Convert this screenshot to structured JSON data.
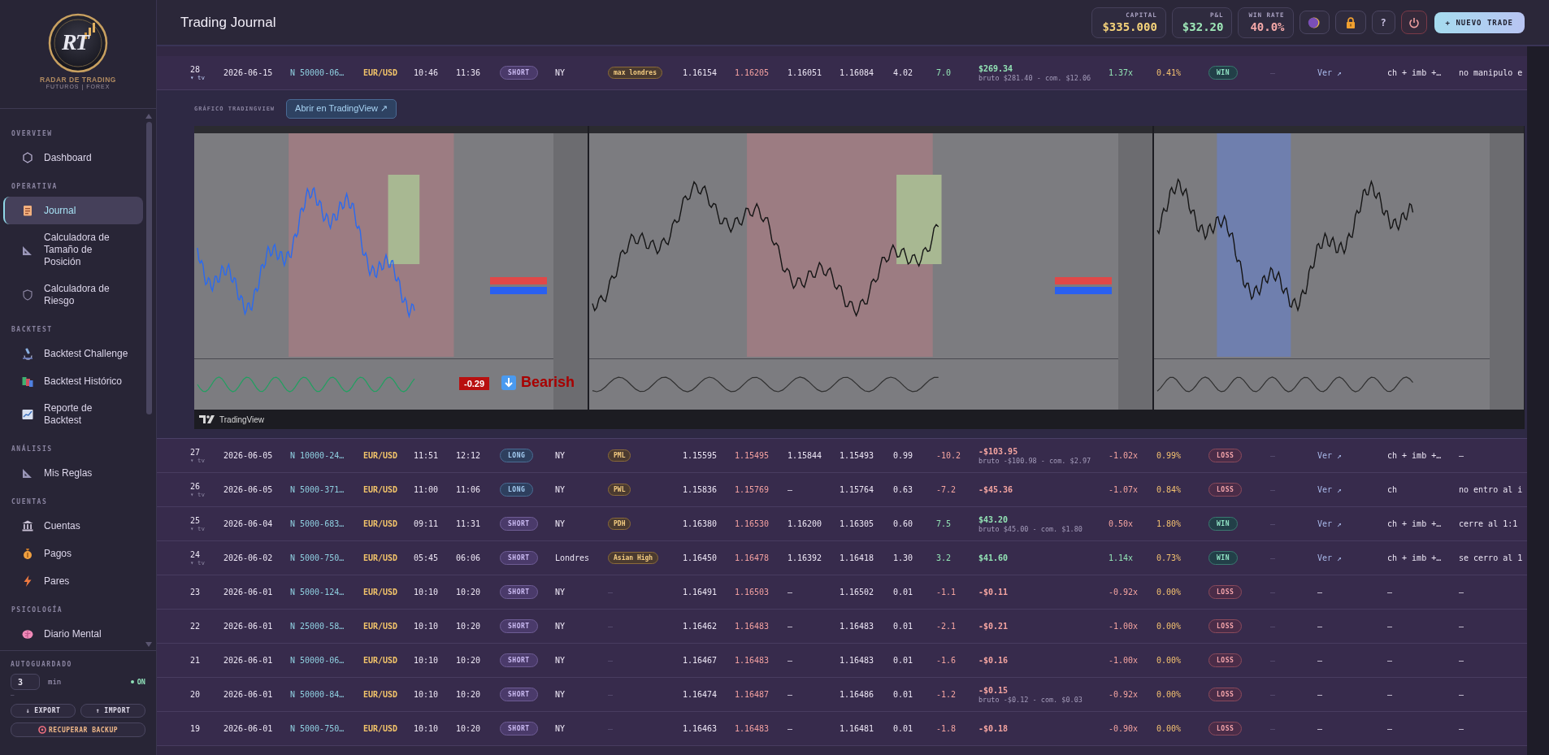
{
  "sidebar": {
    "logo": {
      "mark": "RT",
      "name": "RADAR DE TRADING",
      "tagline": "FUTUROS | FOREX"
    },
    "sections": [
      {
        "title": "OVERVIEW",
        "items": [
          {
            "label": "Dashboard",
            "kind": "hexagon",
            "selected": false
          }
        ]
      },
      {
        "title": "OPERATIVA",
        "items": [
          {
            "label": "Journal",
            "kind": "clipboard",
            "selected": true
          },
          {
            "label": "Calculadora de Tamaño de Posición",
            "kind": "ruler",
            "selected": false
          },
          {
            "label": "Calculadora de Riesgo",
            "kind": "shield",
            "selected": false
          }
        ]
      },
      {
        "title": "BACKTEST",
        "items": [
          {
            "label": "Backtest Challenge",
            "kind": "microscope",
            "selected": false
          },
          {
            "label": "Backtest Histórico",
            "kind": "books",
            "selected": false
          },
          {
            "label": "Reporte de Backtest",
            "kind": "chart",
            "selected": false
          }
        ]
      },
      {
        "title": "ANÁLISIS",
        "items": [
          {
            "label": "Mis Reglas",
            "kind": "ruler",
            "selected": false
          }
        ]
      },
      {
        "title": "CUENTAS",
        "items": [
          {
            "label": "Cuentas",
            "kind": "bank",
            "selected": false
          },
          {
            "label": "Pagos",
            "kind": "moneybag",
            "selected": false
          },
          {
            "label": "Pares",
            "kind": "bolt",
            "selected": false
          }
        ]
      },
      {
        "title": "PSICOLOGÍA",
        "items": [
          {
            "label": "Diario Mental",
            "kind": "brain",
            "selected": false
          }
        ]
      }
    ],
    "autosave": {
      "label": "AUTOGUARDADO",
      "value": "3",
      "unit": "min",
      "status": "ON",
      "on": true,
      "note": "–"
    },
    "buttons": [
      {
        "icon": "↓",
        "label": "EXPORT"
      },
      {
        "icon": "↑",
        "label": "IMPORT"
      }
    ],
    "recover": {
      "label": "RECUPERAR BACKUP"
    }
  },
  "header": {
    "title": "Trading Journal",
    "stats": [
      {
        "label": "CAPITAL",
        "value": "$335.000",
        "color": "#f4d27a"
      },
      {
        "label": "P&L",
        "value": "$32.20",
        "color": "#9ee8b8"
      },
      {
        "label": "WIN RATE",
        "value": "40.0%",
        "color": "#f4a8a8"
      }
    ],
    "icon_buttons": [
      {
        "kind": "moon"
      },
      {
        "kind": "lock"
      },
      {
        "kind": "help",
        "text": "?"
      },
      {
        "kind": "power"
      }
    ],
    "primary": "+ NUEVO TRADE"
  },
  "table": {
    "rows": [
      {
        "expanded": true,
        "cells": [
          {
            "kind": "id",
            "text": "28",
            "sub": "▾ tv"
          },
          {
            "kind": "date",
            "text": "2026-06-15"
          },
          {
            "kind": "account",
            "text": "N 50000-06…"
          },
          {
            "kind": "pair",
            "text": "EUR/USD"
          },
          {
            "kind": "plain",
            "text": "10:46"
          },
          {
            "kind": "plain",
            "text": "11:36"
          },
          {
            "kind": "side-short",
            "text": "SHORT"
          },
          {
            "kind": "plain",
            "text": "NY"
          },
          {
            "kind": "tag",
            "text": "max londres"
          },
          {
            "kind": "plain",
            "text": "1.16154"
          },
          {
            "kind": "stop",
            "text": "1.16205"
          },
          {
            "kind": "plain",
            "text": "1.16051"
          },
          {
            "kind": "plain",
            "text": "1.16084"
          },
          {
            "kind": "plain",
            "text": "4.02"
          },
          {
            "kind": "gain",
            "text": "7.0"
          },
          {
            "kind": "pnl-gain",
            "text": "$269.34",
            "sub": "bruto $281.40 - com. $12.06"
          },
          {
            "kind": "gain",
            "text": "1.37x"
          },
          {
            "kind": "pct",
            "text": "0.41%"
          },
          {
            "kind": "result-win",
            "text": "WIN"
          },
          {
            "kind": "muted",
            "text": "–"
          },
          {
            "kind": "link",
            "text": "Ver ↗"
          },
          {
            "kind": "plain",
            "text": "ch + imb +…"
          },
          {
            "kind": "plain",
            "text": "no manipulo e"
          }
        ],
        "chart": {
          "label": "GRÁFICO TRADINGVIEW",
          "button": "Abrir en TradingView ↗",
          "reading": "-0.29",
          "signal": "Bearish",
          "footer": "TradingView"
        }
      },
      {
        "expanded": false,
        "cells": [
          {
            "kind": "id",
            "text": "27",
            "sub": "▾ tv"
          },
          {
            "kind": "date",
            "text": "2026-06-05"
          },
          {
            "kind": "account",
            "text": "N 10000-24…"
          },
          {
            "kind": "pair",
            "text": "EUR/USD"
          },
          {
            "kind": "plain",
            "text": "11:51"
          },
          {
            "kind": "plain",
            "text": "12:12"
          },
          {
            "kind": "side-long",
            "text": "LONG"
          },
          {
            "kind": "plain",
            "text": "NY"
          },
          {
            "kind": "tag",
            "text": "PML"
          },
          {
            "kind": "plain",
            "text": "1.15595"
          },
          {
            "kind": "stop",
            "text": "1.15495"
          },
          {
            "kind": "plain",
            "text": "1.15844"
          },
          {
            "kind": "plain",
            "text": "1.15493"
          },
          {
            "kind": "plain",
            "text": "0.99"
          },
          {
            "kind": "loss",
            "text": "-10.2"
          },
          {
            "kind": "pnl-loss",
            "text": "-$103.95",
            "sub": "bruto -$100.98 - com. $2.97"
          },
          {
            "kind": "loss",
            "text": "-1.02x"
          },
          {
            "kind": "pct",
            "text": "0.99%"
          },
          {
            "kind": "result-loss",
            "text": "LOSS"
          },
          {
            "kind": "muted",
            "text": "–"
          },
          {
            "kind": "link",
            "text": "Ver ↗"
          },
          {
            "kind": "plain",
            "text": "ch + imb +…"
          },
          {
            "kind": "plain",
            "text": "—"
          }
        ]
      },
      {
        "expanded": false,
        "cells": [
          {
            "kind": "id",
            "text": "26",
            "sub": "▾ tv"
          },
          {
            "kind": "date",
            "text": "2026-06-05"
          },
          {
            "kind": "account",
            "text": "N 5000-371…"
          },
          {
            "kind": "pair",
            "text": "EUR/USD"
          },
          {
            "kind": "plain",
            "text": "11:00"
          },
          {
            "kind": "plain",
            "text": "11:06"
          },
          {
            "kind": "side-long",
            "text": "LONG"
          },
          {
            "kind": "plain",
            "text": "NY"
          },
          {
            "kind": "tag",
            "text": "PWL"
          },
          {
            "kind": "plain",
            "text": "1.15836"
          },
          {
            "kind": "stop",
            "text": "1.15769"
          },
          {
            "kind": "plain",
            "text": "—"
          },
          {
            "kind": "plain",
            "text": "1.15764"
          },
          {
            "kind": "plain",
            "text": "0.63"
          },
          {
            "kind": "loss",
            "text": "-7.2"
          },
          {
            "kind": "pnl-loss",
            "text": "-$45.36"
          },
          {
            "kind": "loss",
            "text": "-1.07x"
          },
          {
            "kind": "pct",
            "text": "0.84%"
          },
          {
            "kind": "result-loss",
            "text": "LOSS"
          },
          {
            "kind": "muted",
            "text": "–"
          },
          {
            "kind": "link",
            "text": "Ver ↗"
          },
          {
            "kind": "plain",
            "text": "ch"
          },
          {
            "kind": "plain",
            "text": "no entro al i"
          }
        ]
      },
      {
        "expanded": false,
        "cells": [
          {
            "kind": "id",
            "text": "25",
            "sub": "▾ tv"
          },
          {
            "kind": "date",
            "text": "2026-06-04"
          },
          {
            "kind": "account",
            "text": "N 5000-683…"
          },
          {
            "kind": "pair",
            "text": "EUR/USD"
          },
          {
            "kind": "plain",
            "text": "09:11"
          },
          {
            "kind": "plain",
            "text": "11:31"
          },
          {
            "kind": "side-short",
            "text": "SHORT"
          },
          {
            "kind": "plain",
            "text": "NY"
          },
          {
            "kind": "tag",
            "text": "PDH"
          },
          {
            "kind": "plain",
            "text": "1.16380"
          },
          {
            "kind": "stop",
            "text": "1.16530"
          },
          {
            "kind": "plain",
            "text": "1.16200"
          },
          {
            "kind": "plain",
            "text": "1.16305"
          },
          {
            "kind": "plain",
            "text": "0.60"
          },
          {
            "kind": "gain",
            "text": "7.5"
          },
          {
            "kind": "pnl-gain",
            "text": "$43.20",
            "sub": "bruto $45.00 - com. $1.80"
          },
          {
            "kind": "loss",
            "text": "0.50x"
          },
          {
            "kind": "pct",
            "text": "1.80%"
          },
          {
            "kind": "result-win",
            "text": "WIN"
          },
          {
            "kind": "muted",
            "text": "–"
          },
          {
            "kind": "link",
            "text": "Ver ↗"
          },
          {
            "kind": "plain",
            "text": "ch + imb +…"
          },
          {
            "kind": "plain",
            "text": "cerre al 1:1"
          }
        ]
      },
      {
        "expanded": false,
        "cells": [
          {
            "kind": "id",
            "text": "24",
            "sub": "▾ tv"
          },
          {
            "kind": "date",
            "text": "2026-06-02"
          },
          {
            "kind": "account",
            "text": "N 5000-750…"
          },
          {
            "kind": "pair",
            "text": "EUR/USD"
          },
          {
            "kind": "plain",
            "text": "05:45"
          },
          {
            "kind": "plain",
            "text": "06:06"
          },
          {
            "kind": "side-short",
            "text": "SHORT"
          },
          {
            "kind": "plain",
            "text": "Londres"
          },
          {
            "kind": "tag",
            "text": "Asian High"
          },
          {
            "kind": "plain",
            "text": "1.16450"
          },
          {
            "kind": "stop",
            "text": "1.16478"
          },
          {
            "kind": "plain",
            "text": "1.16392"
          },
          {
            "kind": "plain",
            "text": "1.16418"
          },
          {
            "kind": "plain",
            "text": "1.30"
          },
          {
            "kind": "gain",
            "text": "3.2"
          },
          {
            "kind": "pnl-gain",
            "text": "$41.60"
          },
          {
            "kind": "gain",
            "text": "1.14x"
          },
          {
            "kind": "pct",
            "text": "0.73%"
          },
          {
            "kind": "result-win",
            "text": "WIN"
          },
          {
            "kind": "muted",
            "text": "–"
          },
          {
            "kind": "link",
            "text": "Ver ↗"
          },
          {
            "kind": "plain",
            "text": "ch + imb +…"
          },
          {
            "kind": "plain",
            "text": "se cerro al 1"
          }
        ]
      },
      {
        "expanded": false,
        "cells": [
          {
            "kind": "id",
            "text": "23"
          },
          {
            "kind": "date",
            "text": "2026-06-01"
          },
          {
            "kind": "account",
            "text": "N 5000-124…"
          },
          {
            "kind": "pair",
            "text": "EUR/USD"
          },
          {
            "kind": "plain",
            "text": "10:10"
          },
          {
            "kind": "plain",
            "text": "10:20"
          },
          {
            "kind": "side-short",
            "text": "SHORT"
          },
          {
            "kind": "plain",
            "text": "NY"
          },
          {
            "kind": "muted",
            "text": "–"
          },
          {
            "kind": "plain",
            "text": "1.16491"
          },
          {
            "kind": "stop",
            "text": "1.16503"
          },
          {
            "kind": "plain",
            "text": "—"
          },
          {
            "kind": "plain",
            "text": "1.16502"
          },
          {
            "kind": "plain",
            "text": "0.01"
          },
          {
            "kind": "loss",
            "text": "-1.1"
          },
          {
            "kind": "pnl-loss",
            "text": "-$0.11"
          },
          {
            "kind": "loss",
            "text": "-0.92x"
          },
          {
            "kind": "pct",
            "text": "0.00%"
          },
          {
            "kind": "result-loss",
            "text": "LOSS"
          },
          {
            "kind": "muted",
            "text": "–"
          },
          {
            "kind": "plain",
            "text": "—"
          },
          {
            "kind": "plain",
            "text": "—"
          },
          {
            "kind": "plain",
            "text": "—"
          }
        ]
      },
      {
        "expanded": false,
        "cells": [
          {
            "kind": "id",
            "text": "22"
          },
          {
            "kind": "date",
            "text": "2026-06-01"
          },
          {
            "kind": "account",
            "text": "N 25000-58…"
          },
          {
            "kind": "pair",
            "text": "EUR/USD"
          },
          {
            "kind": "plain",
            "text": "10:10"
          },
          {
            "kind": "plain",
            "text": "10:20"
          },
          {
            "kind": "side-short",
            "text": "SHORT"
          },
          {
            "kind": "plain",
            "text": "NY"
          },
          {
            "kind": "muted",
            "text": "–"
          },
          {
            "kind": "plain",
            "text": "1.16462"
          },
          {
            "kind": "stop",
            "text": "1.16483"
          },
          {
            "kind": "plain",
            "text": "—"
          },
          {
            "kind": "plain",
            "text": "1.16483"
          },
          {
            "kind": "plain",
            "text": "0.01"
          },
          {
            "kind": "loss",
            "text": "-2.1"
          },
          {
            "kind": "pnl-loss",
            "text": "-$0.21"
          },
          {
            "kind": "loss",
            "text": "-1.00x"
          },
          {
            "kind": "pct",
            "text": "0.00%"
          },
          {
            "kind": "result-loss",
            "text": "LOSS"
          },
          {
            "kind": "muted",
            "text": "–"
          },
          {
            "kind": "plain",
            "text": "—"
          },
          {
            "kind": "plain",
            "text": "—"
          },
          {
            "kind": "plain",
            "text": "—"
          }
        ]
      },
      {
        "expanded": false,
        "cells": [
          {
            "kind": "id",
            "text": "21"
          },
          {
            "kind": "date",
            "text": "2026-06-01"
          },
          {
            "kind": "account",
            "text": "N 50000-06…"
          },
          {
            "kind": "pair",
            "text": "EUR/USD"
          },
          {
            "kind": "plain",
            "text": "10:10"
          },
          {
            "kind": "plain",
            "text": "10:20"
          },
          {
            "kind": "side-short",
            "text": "SHORT"
          },
          {
            "kind": "plain",
            "text": "NY"
          },
          {
            "kind": "muted",
            "text": "–"
          },
          {
            "kind": "plain",
            "text": "1.16467"
          },
          {
            "kind": "stop",
            "text": "1.16483"
          },
          {
            "kind": "plain",
            "text": "—"
          },
          {
            "kind": "plain",
            "text": "1.16483"
          },
          {
            "kind": "plain",
            "text": "0.01"
          },
          {
            "kind": "loss",
            "text": "-1.6"
          },
          {
            "kind": "pnl-loss",
            "text": "-$0.16"
          },
          {
            "kind": "loss",
            "text": "-1.00x"
          },
          {
            "kind": "pct",
            "text": "0.00%"
          },
          {
            "kind": "result-loss",
            "text": "LOSS"
          },
          {
            "kind": "muted",
            "text": "–"
          },
          {
            "kind": "plain",
            "text": "—"
          },
          {
            "kind": "plain",
            "text": "—"
          },
          {
            "kind": "plain",
            "text": "—"
          }
        ]
      },
      {
        "expanded": false,
        "cells": [
          {
            "kind": "id",
            "text": "20"
          },
          {
            "kind": "date",
            "text": "2026-06-01"
          },
          {
            "kind": "account",
            "text": "N 50000-84…"
          },
          {
            "kind": "pair",
            "text": "EUR/USD"
          },
          {
            "kind": "plain",
            "text": "10:10"
          },
          {
            "kind": "plain",
            "text": "10:20"
          },
          {
            "kind": "side-short",
            "text": "SHORT"
          },
          {
            "kind": "plain",
            "text": "NY"
          },
          {
            "kind": "muted",
            "text": "–"
          },
          {
            "kind": "plain",
            "text": "1.16474"
          },
          {
            "kind": "stop",
            "text": "1.16487"
          },
          {
            "kind": "plain",
            "text": "—"
          },
          {
            "kind": "plain",
            "text": "1.16486"
          },
          {
            "kind": "plain",
            "text": "0.01"
          },
          {
            "kind": "loss",
            "text": "-1.2"
          },
          {
            "kind": "pnl-loss",
            "text": "-$0.15",
            "sub": "bruto -$0.12 - com. $0.03"
          },
          {
            "kind": "loss",
            "text": "-0.92x"
          },
          {
            "kind": "pct",
            "text": "0.00%"
          },
          {
            "kind": "result-loss",
            "text": "LOSS"
          },
          {
            "kind": "muted",
            "text": "–"
          },
          {
            "kind": "plain",
            "text": "—"
          },
          {
            "kind": "plain",
            "text": "—"
          },
          {
            "kind": "plain",
            "text": "—"
          }
        ]
      },
      {
        "expanded": false,
        "cells": [
          {
            "kind": "id",
            "text": "19"
          },
          {
            "kind": "date",
            "text": "2026-06-01"
          },
          {
            "kind": "account",
            "text": "N 5000-750…"
          },
          {
            "kind": "pair",
            "text": "EUR/USD"
          },
          {
            "kind": "plain",
            "text": "10:10"
          },
          {
            "kind": "plain",
            "text": "10:20"
          },
          {
            "kind": "side-short",
            "text": "SHORT"
          },
          {
            "kind": "plain",
            "text": "NY"
          },
          {
            "kind": "muted",
            "text": "–"
          },
          {
            "kind": "plain",
            "text": "1.16463"
          },
          {
            "kind": "stop",
            "text": "1.16483"
          },
          {
            "kind": "plain",
            "text": "—"
          },
          {
            "kind": "plain",
            "text": "1.16481"
          },
          {
            "kind": "plain",
            "text": "0.01"
          },
          {
            "kind": "loss",
            "text": "-1.8"
          },
          {
            "kind": "pnl-loss",
            "text": "-$0.18"
          },
          {
            "kind": "loss",
            "text": "-0.90x"
          },
          {
            "kind": "pct",
            "text": "0.00%"
          },
          {
            "kind": "result-loss",
            "text": "LOSS"
          },
          {
            "kind": "muted",
            "text": "–"
          },
          {
            "kind": "plain",
            "text": "—"
          },
          {
            "kind": "plain",
            "text": "—"
          },
          {
            "kind": "plain",
            "text": "—"
          }
        ]
      }
    ]
  }
}
